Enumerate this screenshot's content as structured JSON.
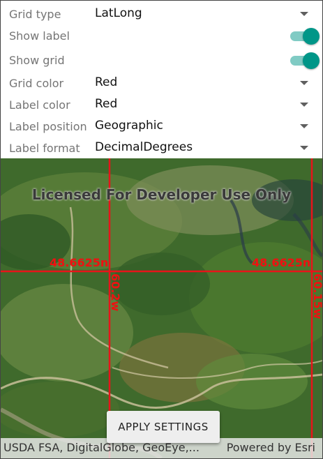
{
  "settings": {
    "grid_type": {
      "label": "Grid type",
      "value": "LatLong"
    },
    "show_label": {
      "label": "Show label",
      "on": true
    },
    "show_grid": {
      "label": "Show grid",
      "on": true
    },
    "grid_color": {
      "label": "Grid color",
      "value": "Red"
    },
    "label_color": {
      "label": "Label color",
      "value": "Red"
    },
    "label_position": {
      "label": "Label position",
      "value": "Geographic"
    },
    "label_format": {
      "label": "Label format",
      "value": "DecimalDegrees"
    }
  },
  "map": {
    "watermark": "Licensed For Developer Use Only",
    "grid_color": "#e8141a",
    "lat_label_left": "48.6625n",
    "lat_label_right": "48.6625n",
    "lon_label_left": "60.2w",
    "lon_label_right": "60.15w"
  },
  "apply_button": "APPLY SETTINGS",
  "attribution": {
    "left": "USDA FSA, DigitalGlobe, GeoEye,...",
    "right": "Powered by Esri"
  },
  "colors": {
    "accent": "#009688",
    "accent_track": "#80cbc4"
  }
}
